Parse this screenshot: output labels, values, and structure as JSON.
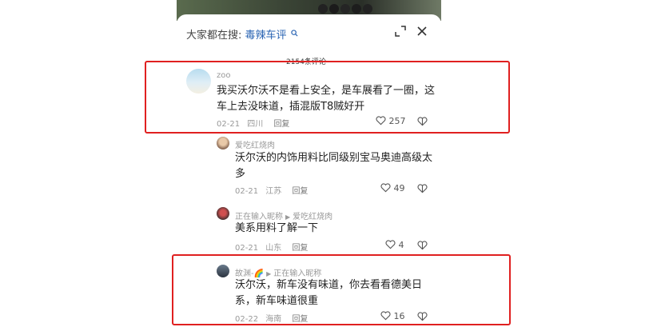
{
  "search": {
    "prefix": "大家都在搜:",
    "term": "毒辣车评"
  },
  "comments_count": "2154条评论",
  "comments": [
    {
      "user": "zoo",
      "text": "我买沃尔沃不是看上安全，是车展看了一圈，这车上去没味道，插混版T8贼好开",
      "date": "02-21",
      "location": "四川",
      "reply": "回复",
      "likes": "257"
    },
    {
      "user": "爱吃红烧肉",
      "text": "沃尔沃的内饰用料比同级别宝马奥迪高级太多",
      "date": "02-21",
      "location": "江苏",
      "reply": "回复",
      "likes": "49"
    },
    {
      "user": "正在输入昵称",
      "reply_to": "爱吃红烧肉",
      "text": "美系用料了解一下",
      "date": "02-21",
      "location": "山东",
      "reply": "回复",
      "likes": "4"
    },
    {
      "user": "故渊-🌈",
      "reply_to": "正在输入昵称",
      "text": "沃尔沃，新车没有味道，你去看看德美日系，新车味道很重",
      "date": "02-22",
      "location": "海南",
      "reply": "回复",
      "likes": "16"
    }
  ],
  "colors": {
    "highlight": "#e02020",
    "link": "#2a64b3"
  }
}
